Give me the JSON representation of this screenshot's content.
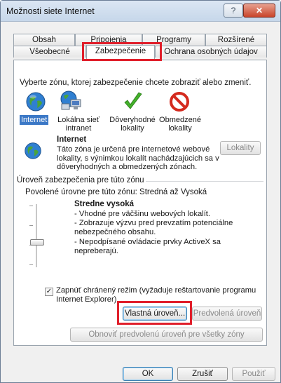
{
  "window": {
    "title": "Možnosti siete Internet"
  },
  "tabs_row1": [
    "Obsah",
    "Pripojenia",
    "Programy",
    "Rozšírené"
  ],
  "tabs_row2": [
    "Všeobecné",
    "Zabezpečenie",
    "Ochrana osobných údajov"
  ],
  "instruction": "Vyberte zónu, ktorej zabezpečenie chcete zobraziť alebo zmeniť.",
  "zones": [
    {
      "label_line1": "Internet",
      "label_line2": "",
      "icon": "globe-icon",
      "selected": true
    },
    {
      "label_line1": "Lokálna sieť",
      "label_line2": "intranet",
      "icon": "intranet-icon",
      "selected": false
    },
    {
      "label_line1": "Dôveryhodné",
      "label_line2": "lokality",
      "icon": "checkmark-icon",
      "selected": false
    },
    {
      "label_line1": "Obmedzené",
      "label_line2": "lokality",
      "icon": "restricted-icon",
      "selected": false
    }
  ],
  "zone_info": {
    "title": "Internet",
    "line1": "Táto zóna je určená pre internetové webové",
    "line2": "lokality, s výnimkou lokalít nachádzajúcich sa v",
    "line3": "dôveryhodných a obmedzených zónach.",
    "sites_button": "Lokality"
  },
  "security_level": {
    "group_title": "Úroveň zabezpečenia pre túto zónu",
    "allowed": "Povolené úrovne pre túto zónu: Stredná až Vysoká",
    "level_name": "Stredne vysoká",
    "bullets": [
      "- Vhodné pre väčšinu webových lokalít.",
      "- Zobrazuje výzvu pred prevzatím potenciálne",
      "nebezpečného obsahu.",
      "- Nepodpísané ovládacie prvky ActiveX sa nepreberajú."
    ],
    "protected_mode_line1": "Zapnúť chránený režim (vyžaduje reštartovanie programu",
    "protected_mode_line2": "Internet Explorer)",
    "protected_mode_checked": true,
    "custom_button": "Vlastná úroveň...",
    "default_button": "Predvolená úroveň",
    "reset_all_button": "Obnoviť predvolenú úroveň pre všetky zóny"
  },
  "footer": {
    "ok": "OK",
    "cancel": "Zrušiť",
    "apply": "Použiť"
  },
  "colors": {
    "highlight": "#e01f2b",
    "selection": "#3b78c6"
  }
}
